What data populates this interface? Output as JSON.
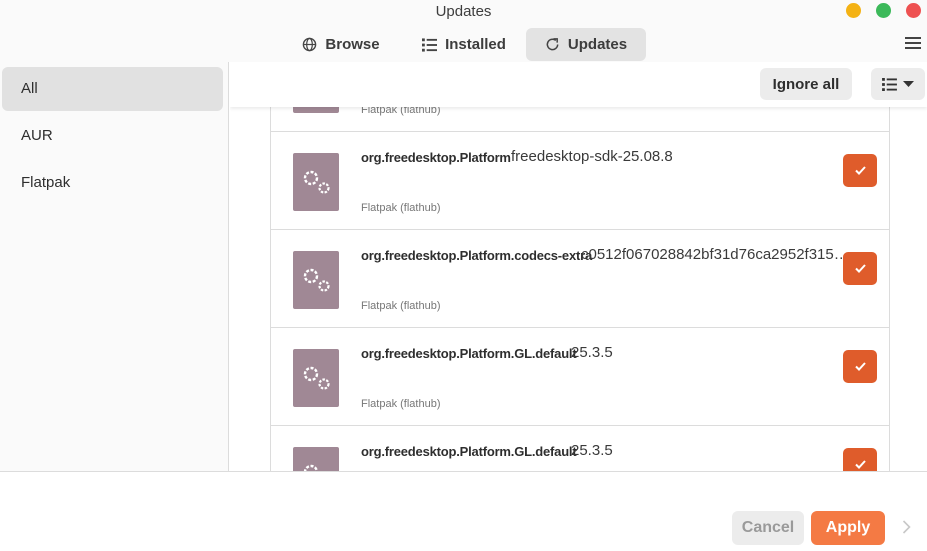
{
  "window": {
    "title": "Updates"
  },
  "header": {
    "tabs": [
      {
        "label": "Browse",
        "icon": "globe-icon"
      },
      {
        "label": "Installed",
        "icon": "list-icon"
      },
      {
        "label": "Updates",
        "icon": "refresh-icon",
        "active": true
      }
    ],
    "menu_icon": "hamburger-menu-icon"
  },
  "sidebar": {
    "items": [
      {
        "label": "All",
        "active": true
      },
      {
        "label": "AUR"
      },
      {
        "label": "Flatpak"
      }
    ]
  },
  "toolbar": {
    "ignore_all_label": "Ignore all",
    "view_icon": "list-view-icon"
  },
  "packages": [
    {
      "name": "",
      "version": "",
      "repo": "Flatpak (flathub)",
      "checked": true
    },
    {
      "name": "org.freedesktop.Platform",
      "version": "freedesktop-sdk-25.08.8",
      "repo": "Flatpak (flathub)",
      "checked": true
    },
    {
      "name": "org.freedesktop.Platform.codecs-extra",
      "version": "c0512f067028842bf31d76ca2952f315…",
      "repo": "Flatpak (flathub)",
      "checked": true
    },
    {
      "name": "org.freedesktop.Platform.GL.default",
      "version": "25.3.5",
      "repo": "Flatpak (flathub)",
      "checked": true
    },
    {
      "name": "org.freedesktop.Platform.GL.default",
      "version": "25.3.5",
      "repo": "",
      "checked": true
    }
  ],
  "footer": {
    "cancel_label": "Cancel",
    "apply_label": "Apply"
  },
  "colors": {
    "accent": "#f47a44",
    "checkbox": "#df5c2b",
    "package_icon": "#a08895"
  }
}
